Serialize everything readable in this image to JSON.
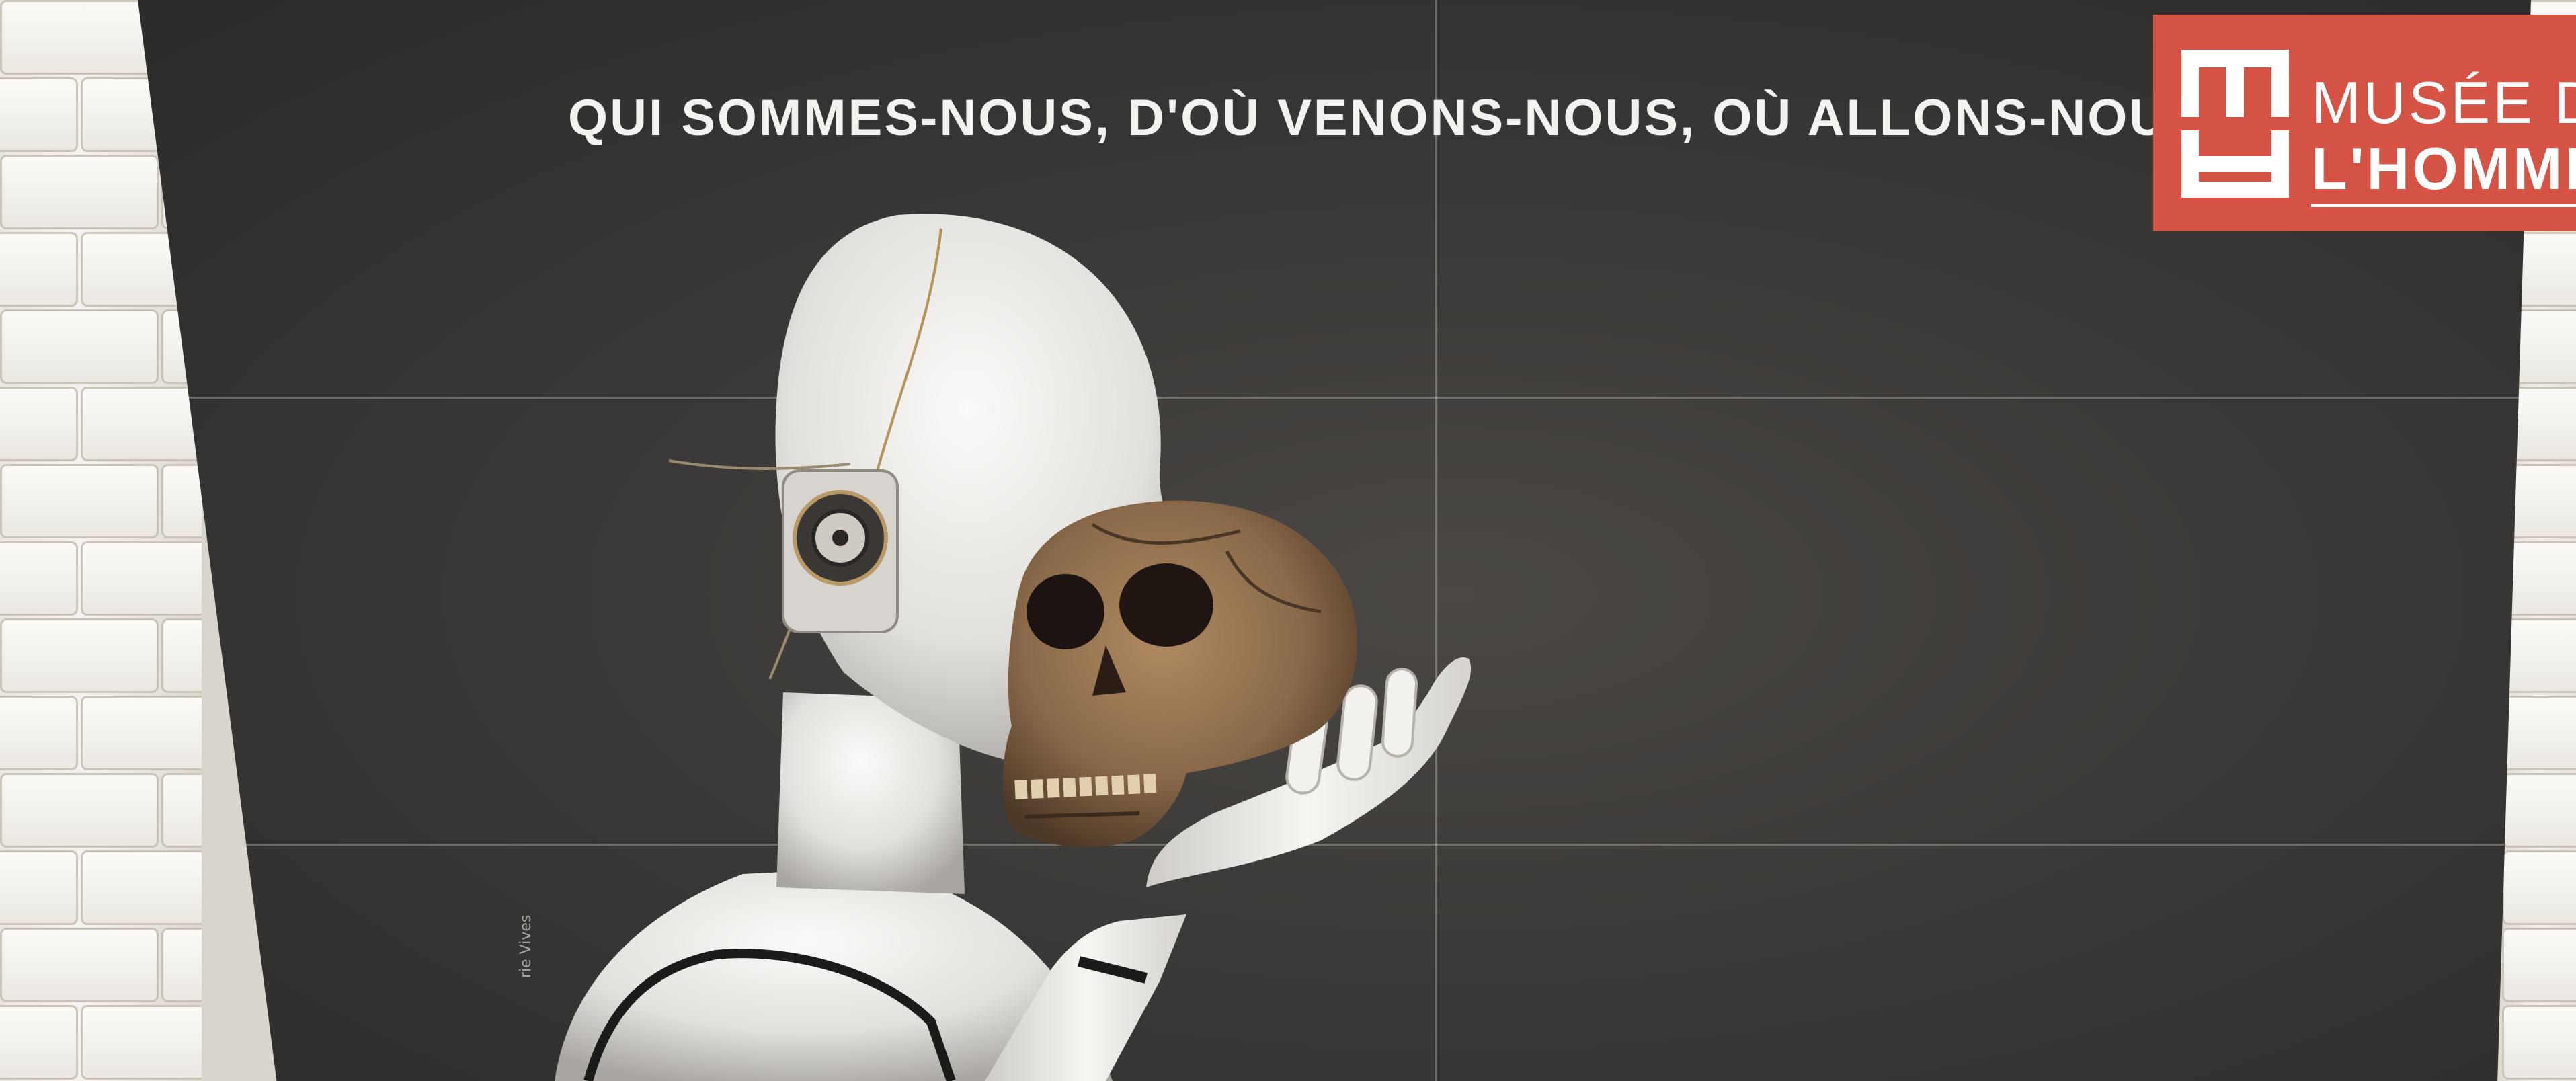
{
  "poster": {
    "headline": "QUI SOMMES-NOUS, D'OÙ VENONS-NOUS, OÙ ALLONS-NOUS ?",
    "logo": {
      "line1": "MUSÉE DE",
      "line2": "L'HOMME"
    },
    "credit": "rie Vives"
  },
  "colors": {
    "poster_background": "#3b3937",
    "logo_red": "#d55344",
    "headline_white": "#f4f2ee",
    "robot_white": "#e8e6e2",
    "skull_brown": "#8a6a4a"
  }
}
